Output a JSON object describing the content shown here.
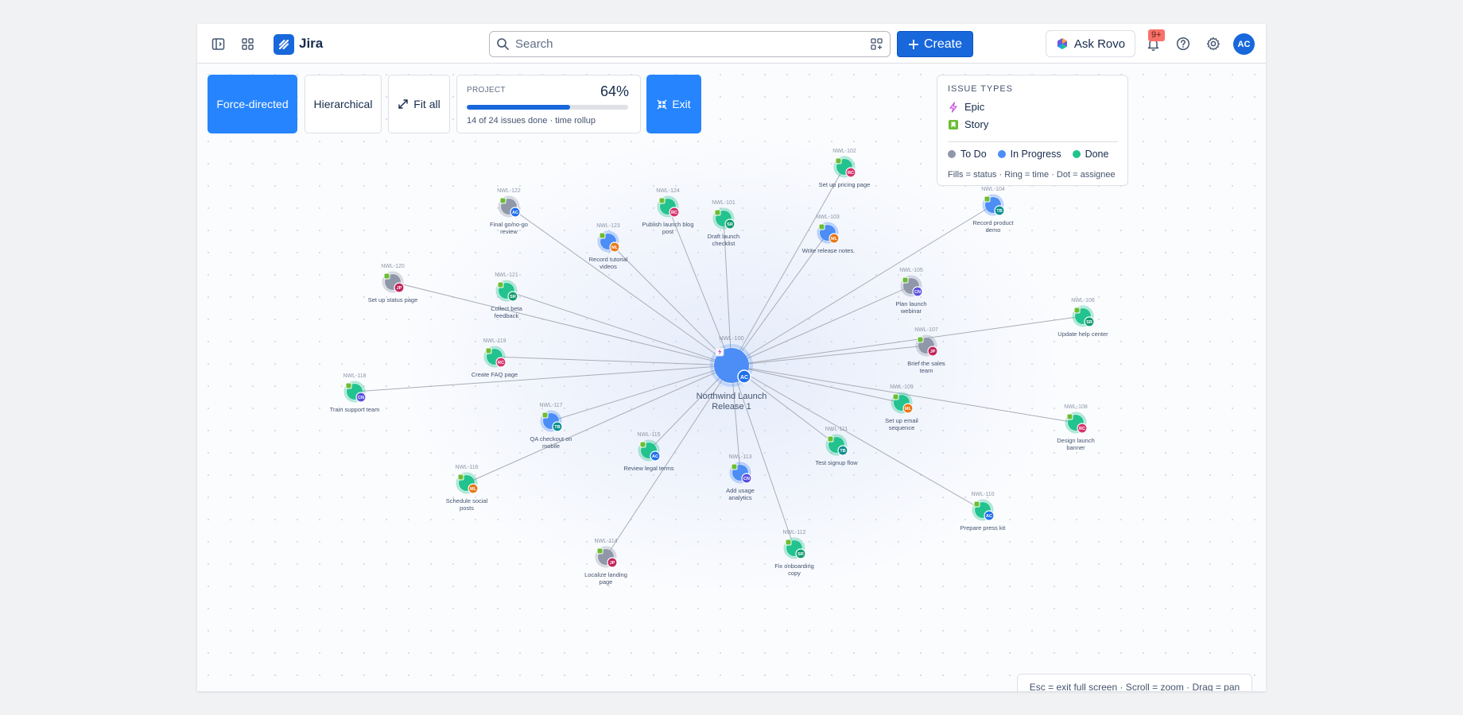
{
  "colors": {
    "brand": "#1868db",
    "accent": "#2684ff",
    "todo": "#8f97a8",
    "inprogress": "#4c8df6",
    "done": "#22c38e",
    "epic": "#c459d9",
    "story": "#6bbd33",
    "edge": "#a9adb6"
  },
  "nav": {
    "logo_text": "Jira",
    "search_placeholder": "Search",
    "create_label": "Create",
    "ask_rovo_label": "Ask Rovo",
    "notifications_badge": "9+",
    "avatar_initials": "AC",
    "icons": [
      "sidebar-toggle-icon",
      "app-switcher-icon",
      "search-icon",
      "command-icon",
      "plus-icon",
      "rovo-icon",
      "bell-icon",
      "help-icon",
      "settings-icon"
    ]
  },
  "toolbar": {
    "force_label": "Force-directed",
    "hier_label": "Hierarchical",
    "fit_label": "Fit all",
    "exit_label": "Exit"
  },
  "project": {
    "label": "PROJECT",
    "percent_text": "64%",
    "progress": 0.64,
    "summary": "14 of 24 issues done · time rollup"
  },
  "legend": {
    "title": "ISSUE TYPES",
    "epic_label": "Epic",
    "story_label": "Story",
    "todo_label": "To Do",
    "inprogress_label": "In Progress",
    "done_label": "Done",
    "note": "Fills = status · Ring = time · Dot = assignee"
  },
  "hint": "Esc = exit full screen · Scroll = zoom · Drag = pan",
  "graph": {
    "center": {
      "key": "NWL-100",
      "title_lines": [
        "Northwind Launch",
        "Release 1"
      ],
      "status": "inprogress",
      "assignee": "AC"
    },
    "nodes": [
      {
        "key": "NWL-101",
        "title_lines": [
          "Draft launch",
          "checklist"
        ],
        "status": "done",
        "assignee": "SR"
      },
      {
        "key": "NWL-102",
        "title_lines": [
          "Set up pricing page"
        ],
        "status": "done",
        "assignee": "RC"
      },
      {
        "key": "NWL-103",
        "title_lines": [
          "Write release notes"
        ],
        "status": "inprogress",
        "assignee": "ML"
      },
      {
        "key": "NWL-104",
        "title_lines": [
          "Record product",
          "demo"
        ],
        "status": "inprogress",
        "assignee": "TB"
      },
      {
        "key": "NWL-105",
        "title_lines": [
          "Plan launch",
          "webinar"
        ],
        "status": "todo",
        "assignee": "CN"
      },
      {
        "key": "NWL-106",
        "title_lines": [
          "Update help center"
        ],
        "status": "done",
        "assignee": "SR"
      },
      {
        "key": "NWL-107",
        "title_lines": [
          "Brief the sales",
          "team"
        ],
        "status": "todo",
        "assignee": "JP"
      },
      {
        "key": "NWL-108",
        "title_lines": [
          "Design launch",
          "banner"
        ],
        "status": "done",
        "assignee": "RC"
      },
      {
        "key": "NWL-109",
        "title_lines": [
          "Set up email",
          "sequence"
        ],
        "status": "done",
        "assignee": "ML"
      },
      {
        "key": "NWL-110",
        "title_lines": [
          "Prepare press kit"
        ],
        "status": "done",
        "assignee": "AC"
      },
      {
        "key": "NWL-111",
        "title_lines": [
          "Test signup flow"
        ],
        "status": "done",
        "assignee": "TB"
      },
      {
        "key": "NWL-112",
        "title_lines": [
          "Fix onboarding",
          "copy"
        ],
        "status": "done",
        "assignee": "SR"
      },
      {
        "key": "NWL-113",
        "title_lines": [
          "Add usage",
          "analytics"
        ],
        "status": "inprogress",
        "assignee": "CN"
      },
      {
        "key": "NWL-114",
        "title_lines": [
          "Localize landing",
          "page"
        ],
        "status": "todo",
        "assignee": "JP"
      },
      {
        "key": "NWL-115",
        "title_lines": [
          "Review legal terms"
        ],
        "status": "done",
        "assignee": "AC"
      },
      {
        "key": "NWL-116",
        "title_lines": [
          "Schedule social",
          "posts"
        ],
        "status": "done",
        "assignee": "ML"
      },
      {
        "key": "NWL-117",
        "title_lines": [
          "QA checkout on",
          "mobile"
        ],
        "status": "inprogress",
        "assignee": "TB"
      },
      {
        "key": "NWL-118",
        "title_lines": [
          "Train support team"
        ],
        "status": "done",
        "assignee": "CN"
      },
      {
        "key": "NWL-119",
        "title_lines": [
          "Create FAQ page"
        ],
        "status": "done",
        "assignee": "RC"
      },
      {
        "key": "NWL-120",
        "title_lines": [
          "Set up status page"
        ],
        "status": "todo",
        "assignee": "JP"
      },
      {
        "key": "NWL-121",
        "title_lines": [
          "Collect beta",
          "feedback"
        ],
        "status": "done",
        "assignee": "SR"
      },
      {
        "key": "NWL-122",
        "title_lines": [
          "Final go/no-go",
          "review"
        ],
        "status": "todo",
        "assignee": "AC"
      },
      {
        "key": "NWL-123",
        "title_lines": [
          "Record tutorial",
          "videos"
        ],
        "status": "inprogress",
        "assignee": "ML"
      },
      {
        "key": "NWL-124",
        "title_lines": [
          "Publish launch blog",
          "post"
        ],
        "status": "done",
        "assignee": "RC"
      }
    ],
    "assignee_colors": {
      "AC": "#1f6feb",
      "SR": "#0f9d6e",
      "RC": "#d6336c",
      "ML": "#e8781a",
      "TB": "#0b8f8f",
      "CN": "#5a4fe0",
      "JP": "#c2255c"
    }
  }
}
